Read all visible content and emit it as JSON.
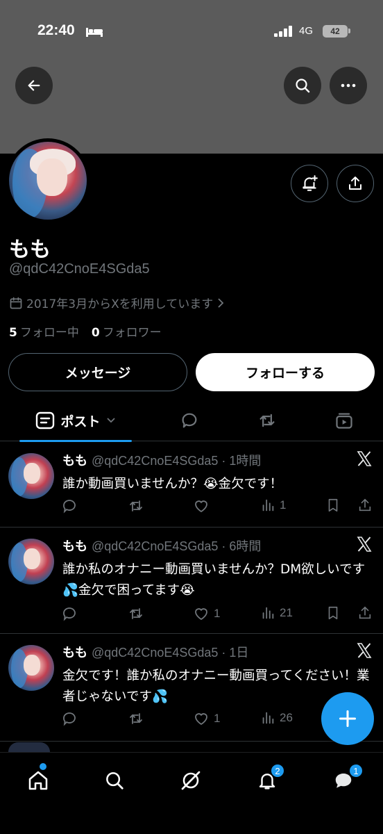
{
  "status_bar": {
    "time": "22:40",
    "network": "4G",
    "battery": "42"
  },
  "profile": {
    "display_name": "もも",
    "handle": "@qdC42CnoE4SGda5",
    "joined": "2017年3月からXを利用しています",
    "following_count": "5",
    "following_label": "フォロー中",
    "followers_count": "0",
    "followers_label": "フォロワー"
  },
  "buttons": {
    "message": "メッセージ",
    "follow": "フォローする"
  },
  "tabs": {
    "posts_label": "ポスト"
  },
  "posts": [
    {
      "name": "もも",
      "handle_time": "@qdC42CnoE4SGda5 · 1時間",
      "text": "誰か動画買いませんか？😭金欠です！",
      "replies": "",
      "reposts": "",
      "likes": "",
      "views": "1"
    },
    {
      "name": "もも",
      "handle_time": "@qdC42CnoE4SGda5 · 6時間",
      "text": "誰か私のオナニー動画買いませんか？DM欲しいです💦金欠で困ってます😭",
      "replies": "",
      "reposts": "",
      "likes": "1",
      "views": "21"
    },
    {
      "name": "もも",
      "handle_time": "@qdC42CnoE4SGda5 · 1日",
      "text": "金欠です！誰か私のオナニー動画買ってください！業者じゃないです💦",
      "replies": "",
      "reposts": "",
      "likes": "1",
      "views": "26"
    }
  ],
  "bottom_nav": {
    "notifications_badge": "2",
    "messages_badge": "1"
  },
  "colors": {
    "accent": "#1d9bf0",
    "banner": "#5b5b5b",
    "muted": "#71767b"
  },
  "icons": [
    "back-arrow-icon",
    "search-icon",
    "more-icon",
    "bell-plus-icon",
    "share-icon",
    "calendar-icon",
    "chevron-right-icon",
    "x-logo-icon",
    "reply-icon",
    "repost-icon",
    "like-icon",
    "views-icon",
    "bookmark-icon",
    "home-icon",
    "grok-icon",
    "bell-icon",
    "messages-icon",
    "plus-icon"
  ]
}
